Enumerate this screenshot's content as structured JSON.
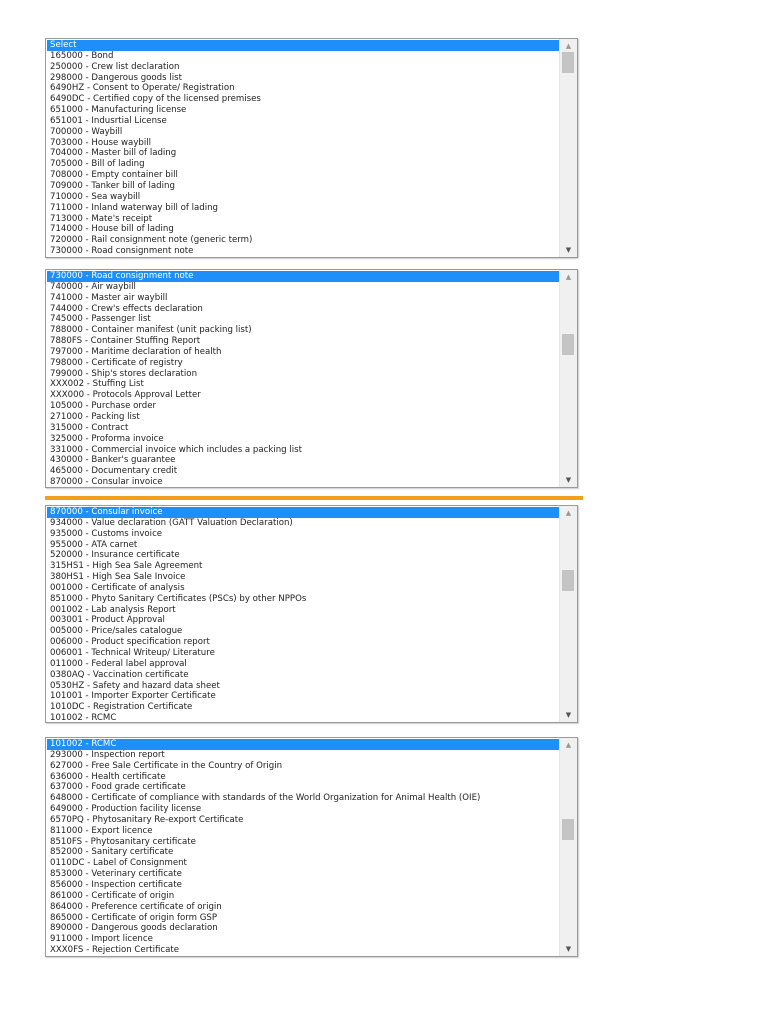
{
  "colors": {
    "selected": "#1e8ff8",
    "divider": "#f2a01c"
  },
  "lists": [
    {
      "scroll_fraction": 0.0,
      "items": [
        "Select",
        "165000 - Bond",
        "250000 - Crew list declaration",
        "298000 - Dangerous goods list",
        "6490HZ - Consent to Operate/ Registration",
        "6490DC - Certified copy of the licensed premises",
        "651000 - Manufacturing license",
        "651001 - Indusrtial License",
        "700000 - Waybill",
        "703000 - House waybill",
        "704000 - Master bill of lading",
        "705000 - Bill of lading",
        "708000 - Empty container bill",
        "709000 - Tanker bill of lading",
        "710000 - Sea waybill",
        "711000 - Inland waterway bill of lading",
        "713000 - Mate's receipt",
        "714000 - House bill of lading",
        "720000 - Rail consignment note (generic term)",
        "730000 - Road consignment note"
      ]
    },
    {
      "scroll_fraction": 0.3,
      "items": [
        "730000 - Road consignment note",
        "740000 - Air waybill",
        "741000 - Master air waybill",
        "744000 - Crew's effects declaration",
        "745000 - Passenger list",
        "788000 - Container manifest (unit packing list)",
        "7880FS - Container Stuffing Report",
        "797000 - Maritime declaration of health",
        "798000 - Certificate of registry",
        "799000 - Ship's stores declaration",
        "XXX002 - Stuffing List",
        "XXX000 - Protocols Approval Letter",
        "105000 - Purchase order",
        "271000 - Packing list",
        "315000 - Contract",
        "325000 - Proforma invoice",
        "331000 - Commercial invoice which includes a packing list",
        "430000 - Banker's guarantee",
        "465000 - Documentary credit",
        "870000 - Consular invoice"
      ]
    },
    {
      "scroll_fraction": 0.3,
      "items": [
        "870000 - Consular invoice",
        "934000 - Value declaration (GATT Valuation Declaration)",
        "935000 - Customs invoice",
        "955000 - ATA carnet",
        "520000 - Insurance certificate",
        "315HS1 - High Sea Sale Agreement",
        "380HS1 - High Sea Sale Invoice",
        "001000 - Certificate of analysis",
        "851000 - Phyto Sanitary Certificates (PSCs) by other NPPOs",
        "001002 - Lab analysis Report",
        "003001 - Product Approval",
        "005000 - Price/sales catalogue",
        "006000 - Product specification report",
        "006001 - Technical Writeup/ Literature",
        "011000 - Federal label approval",
        "0380AQ - Vaccination certificate",
        "0530HZ - Safety and hazard data sheet",
        "101001 - Importer Exporter Certificate",
        "1010DC - Registration Certificate",
        "101002 - RCMC"
      ]
    },
    {
      "scroll_fraction": 0.4,
      "items": [
        "101002 - RCMC",
        "293000 - Inspection report",
        "627000 - Free Sale Certificate in the Country of Origin",
        "636000 - Health certificate",
        "637000 - Food grade certificate",
        "648000 - Certificate of compliance with standards of the World Organization for Animal Health (OIE)",
        "649000 - Production facility license",
        "6570PQ - Phytosanitary Re-export Certificate",
        "811000 - Export licence",
        "8510FS - Phytosanitary certificate",
        "852000 - Sanitary certificate",
        "0110DC - Label of Consignment",
        "853000 - Veterinary certificate",
        "856000 - Inspection certificate",
        "861000 - Certificate of origin",
        "864000 - Preference certificate of origin",
        "865000 - Certificate of origin form GSP",
        "890000 - Dangerous goods declaration",
        "911000 - Import licence",
        "XXX0FS - Rejection Certificate"
      ]
    }
  ]
}
